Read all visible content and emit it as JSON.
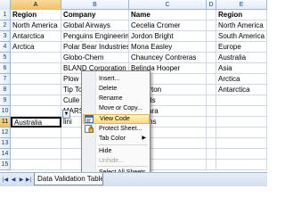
{
  "columns": [
    "A",
    "B",
    "C",
    "D",
    "E"
  ],
  "active_column": "A",
  "active_row": "11",
  "rows": [
    {
      "num": "1",
      "cells": [
        "Region",
        "Company",
        "Name",
        "",
        "Region"
      ]
    },
    {
      "num": "2",
      "cells": [
        "North America",
        "Global Airways",
        "Cecelia Cromer",
        "",
        "North America"
      ]
    },
    {
      "num": "3",
      "cells": [
        "Antarctica",
        "Penguins Engineering",
        "Jordon Bright",
        "",
        "South America"
      ]
    },
    {
      "num": "4",
      "cells": [
        "Arctica",
        "Polar Bear Industries",
        "Mona Easley",
        "",
        "Europe"
      ]
    },
    {
      "num": "5",
      "cells": [
        "",
        "Globo-Chem",
        "Chauncey Contreras",
        "",
        "Australia"
      ]
    },
    {
      "num": "6",
      "cells": [
        "",
        "BLAND Corporation",
        "Belinda Hooper",
        "",
        "Asia"
      ]
    },
    {
      "num": "7",
      "cells": [
        "",
        "Plow",
        "lley",
        "",
        "Arctica"
      ]
    },
    {
      "num": "8",
      "cells": [
        "",
        "Tip To",
        "a Thorton",
        "",
        "Antarctica"
      ]
    },
    {
      "num": "9",
      "cells": [
        "",
        "Culle",
        "y Fields",
        "",
        ""
      ]
    },
    {
      "num": "10",
      "cells": [
        "",
        "MARS",
        "Guevara",
        "",
        ""
      ]
    },
    {
      "num": "11",
      "cells": [
        "Australia",
        "lini",
        "Hoskins",
        "",
        ""
      ]
    },
    {
      "num": "12",
      "cells": [
        "",
        "",
        "",
        "",
        ""
      ]
    },
    {
      "num": "13",
      "cells": [
        "",
        "",
        "",
        "",
        ""
      ]
    },
    {
      "num": "14",
      "cells": [
        "",
        "",
        "",
        "",
        ""
      ]
    },
    {
      "num": "15",
      "cells": [
        "",
        "",
        "",
        "",
        ""
      ]
    }
  ],
  "context_menu": {
    "items": [
      {
        "label": "Insert...",
        "icon": "",
        "disabled": false,
        "submenu": false
      },
      {
        "label": "Delete",
        "icon": "",
        "disabled": false,
        "submenu": false
      },
      {
        "label": "Rename",
        "icon": "",
        "disabled": false,
        "submenu": false
      },
      {
        "label": "Move or Copy...",
        "icon": "",
        "disabled": false,
        "submenu": false
      },
      {
        "label": "View Code",
        "icon": "view-code-icon",
        "disabled": false,
        "submenu": false,
        "hover": true
      },
      {
        "label": "Protect Sheet...",
        "icon": "protect-sheet-icon",
        "disabled": false,
        "submenu": false
      },
      {
        "label": "Tab Color",
        "icon": "",
        "disabled": false,
        "submenu": true
      },
      {
        "label": "Hide",
        "icon": "",
        "disabled": false,
        "submenu": false
      },
      {
        "label": "Unhide...",
        "icon": "",
        "disabled": true,
        "submenu": false
      },
      {
        "label": "Select All Sheets",
        "icon": "",
        "disabled": false,
        "submenu": false
      }
    ]
  },
  "tabbar": {
    "nav_icons": [
      "first-sheet-icon",
      "prev-sheet-icon",
      "next-sheet-icon",
      "last-sheet-icon"
    ],
    "active_tab": "Data Validation Tables"
  },
  "colors": {
    "header_blue": "#15428b",
    "active_header": "#f1c15f",
    "menu_hover": "#ffd77a"
  }
}
